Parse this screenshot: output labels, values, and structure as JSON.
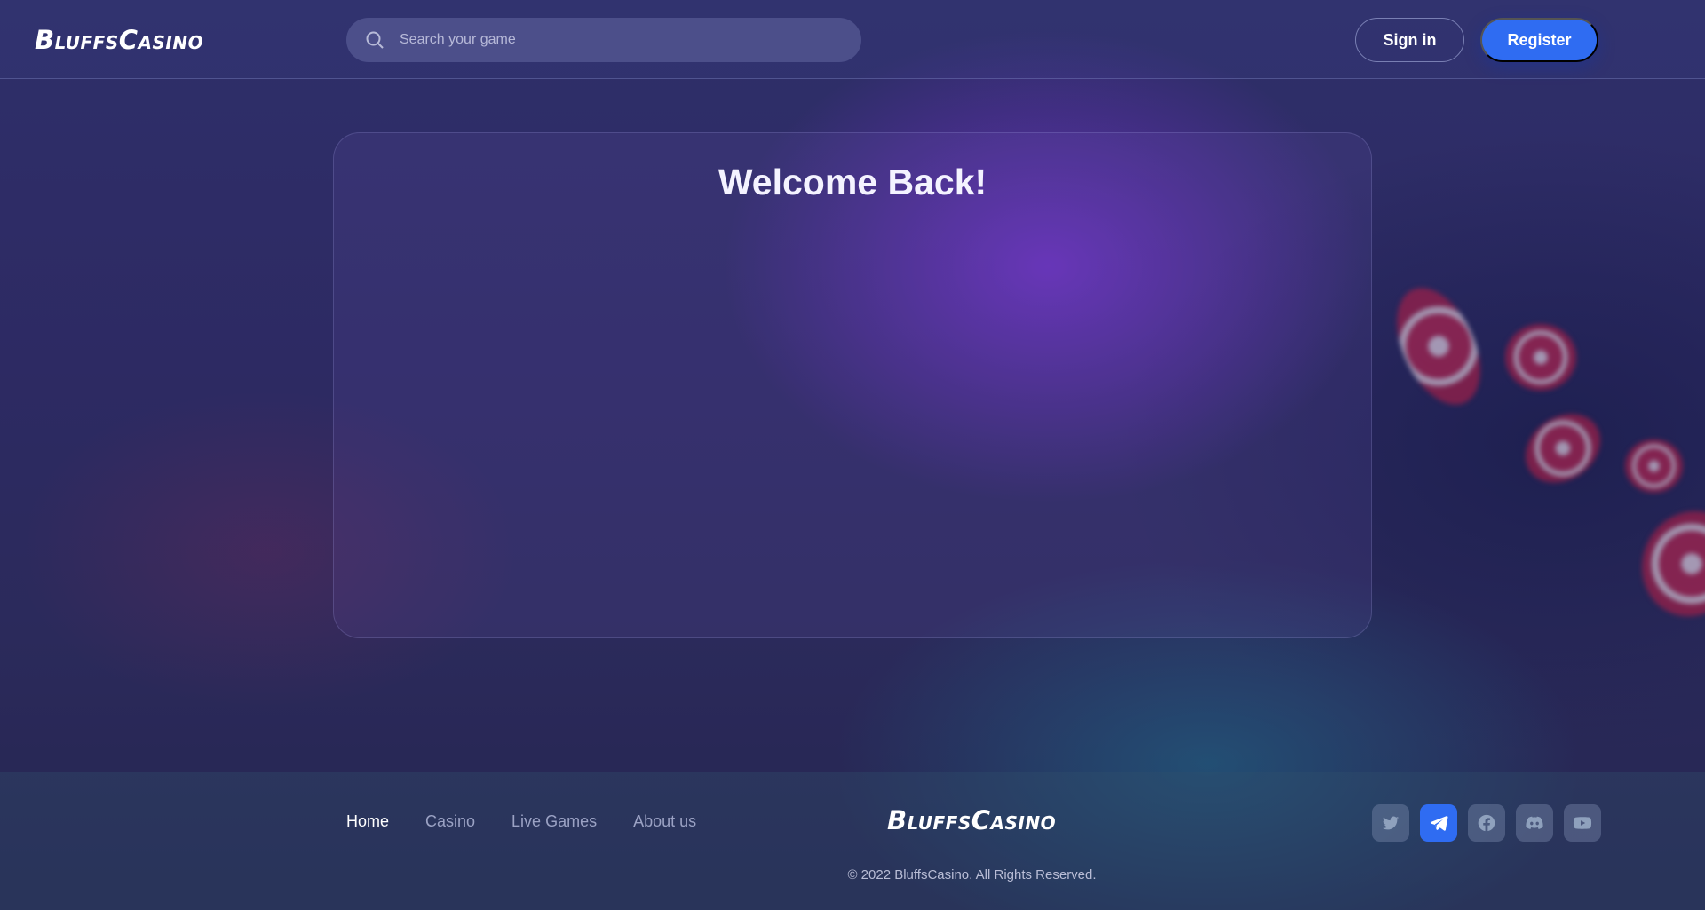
{
  "brand": {
    "first": "Bluffs",
    "second": "Casino"
  },
  "search": {
    "placeholder": "Search your game",
    "icon": "search-icon"
  },
  "auth": {
    "signin_label": "Sign in",
    "register_label": "Register"
  },
  "card": {
    "title": "Welcome Back!"
  },
  "footer": {
    "nav": [
      "Home",
      "Casino",
      "Live Games",
      "About us"
    ],
    "active_nav": "Home",
    "socials": [
      "twitter-icon",
      "telegram-icon",
      "facebook-icon",
      "discord-icon",
      "youtube-icon"
    ],
    "active_social": "telegram-icon",
    "copyright": "© 2022 BluffsCasino. All Rights Reserved."
  },
  "colors": {
    "accent": "#2f6cf2",
    "background": "#2b2a5b"
  }
}
